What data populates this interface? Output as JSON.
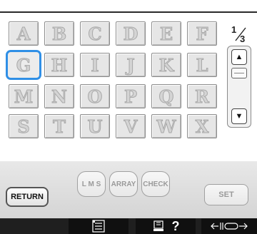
{
  "letters": {
    "rows": [
      [
        "A",
        "B",
        "C",
        "D",
        "E",
        "F"
      ],
      [
        "G",
        "H",
        "I",
        "J",
        "K",
        "L"
      ],
      [
        "M",
        "N",
        "O",
        "P",
        "Q",
        "R"
      ],
      [
        "S",
        "T",
        "U",
        "V",
        "W",
        "X"
      ]
    ],
    "selected": "G"
  },
  "page": {
    "numerator": "1",
    "denominator": "3"
  },
  "buttons": {
    "return": "RETURN",
    "lms": "L M S",
    "array": "ARRAY",
    "check": "CHECK",
    "set": "SET"
  },
  "footer": {
    "help_text": "?",
    "icons": [
      "settings-list-icon",
      "help-sewing-icon",
      "width-arrows-icon"
    ]
  },
  "colors": {
    "selection": "#2f8fe6",
    "footer": "#1f1f1f"
  }
}
